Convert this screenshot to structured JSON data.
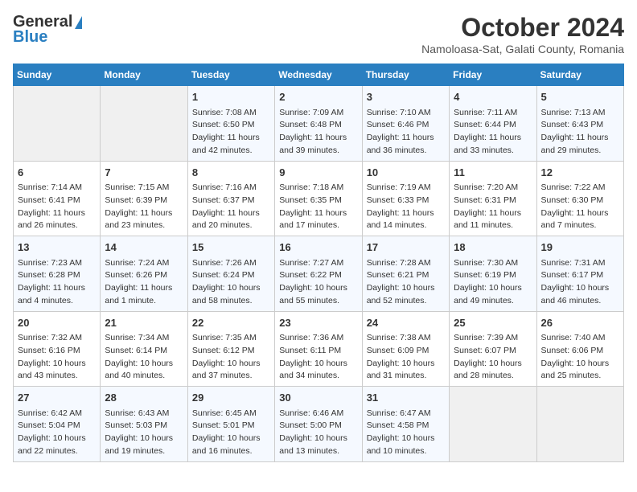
{
  "logo": {
    "line1": "General",
    "line2": "Blue"
  },
  "title": "October 2024",
  "location": "Namoloasa-Sat, Galati County, Romania",
  "days_header": [
    "Sunday",
    "Monday",
    "Tuesday",
    "Wednesday",
    "Thursday",
    "Friday",
    "Saturday"
  ],
  "weeks": [
    [
      {
        "day": "",
        "info": ""
      },
      {
        "day": "",
        "info": ""
      },
      {
        "day": "1",
        "info": "Sunrise: 7:08 AM\nSunset: 6:50 PM\nDaylight: 11 hours and 42 minutes."
      },
      {
        "day": "2",
        "info": "Sunrise: 7:09 AM\nSunset: 6:48 PM\nDaylight: 11 hours and 39 minutes."
      },
      {
        "day": "3",
        "info": "Sunrise: 7:10 AM\nSunset: 6:46 PM\nDaylight: 11 hours and 36 minutes."
      },
      {
        "day": "4",
        "info": "Sunrise: 7:11 AM\nSunset: 6:44 PM\nDaylight: 11 hours and 33 minutes."
      },
      {
        "day": "5",
        "info": "Sunrise: 7:13 AM\nSunset: 6:43 PM\nDaylight: 11 hours and 29 minutes."
      }
    ],
    [
      {
        "day": "6",
        "info": "Sunrise: 7:14 AM\nSunset: 6:41 PM\nDaylight: 11 hours and 26 minutes."
      },
      {
        "day": "7",
        "info": "Sunrise: 7:15 AM\nSunset: 6:39 PM\nDaylight: 11 hours and 23 minutes."
      },
      {
        "day": "8",
        "info": "Sunrise: 7:16 AM\nSunset: 6:37 PM\nDaylight: 11 hours and 20 minutes."
      },
      {
        "day": "9",
        "info": "Sunrise: 7:18 AM\nSunset: 6:35 PM\nDaylight: 11 hours and 17 minutes."
      },
      {
        "day": "10",
        "info": "Sunrise: 7:19 AM\nSunset: 6:33 PM\nDaylight: 11 hours and 14 minutes."
      },
      {
        "day": "11",
        "info": "Sunrise: 7:20 AM\nSunset: 6:31 PM\nDaylight: 11 hours and 11 minutes."
      },
      {
        "day": "12",
        "info": "Sunrise: 7:22 AM\nSunset: 6:30 PM\nDaylight: 11 hours and 7 minutes."
      }
    ],
    [
      {
        "day": "13",
        "info": "Sunrise: 7:23 AM\nSunset: 6:28 PM\nDaylight: 11 hours and 4 minutes."
      },
      {
        "day": "14",
        "info": "Sunrise: 7:24 AM\nSunset: 6:26 PM\nDaylight: 11 hours and 1 minute."
      },
      {
        "day": "15",
        "info": "Sunrise: 7:26 AM\nSunset: 6:24 PM\nDaylight: 10 hours and 58 minutes."
      },
      {
        "day": "16",
        "info": "Sunrise: 7:27 AM\nSunset: 6:22 PM\nDaylight: 10 hours and 55 minutes."
      },
      {
        "day": "17",
        "info": "Sunrise: 7:28 AM\nSunset: 6:21 PM\nDaylight: 10 hours and 52 minutes."
      },
      {
        "day": "18",
        "info": "Sunrise: 7:30 AM\nSunset: 6:19 PM\nDaylight: 10 hours and 49 minutes."
      },
      {
        "day": "19",
        "info": "Sunrise: 7:31 AM\nSunset: 6:17 PM\nDaylight: 10 hours and 46 minutes."
      }
    ],
    [
      {
        "day": "20",
        "info": "Sunrise: 7:32 AM\nSunset: 6:16 PM\nDaylight: 10 hours and 43 minutes."
      },
      {
        "day": "21",
        "info": "Sunrise: 7:34 AM\nSunset: 6:14 PM\nDaylight: 10 hours and 40 minutes."
      },
      {
        "day": "22",
        "info": "Sunrise: 7:35 AM\nSunset: 6:12 PM\nDaylight: 10 hours and 37 minutes."
      },
      {
        "day": "23",
        "info": "Sunrise: 7:36 AM\nSunset: 6:11 PM\nDaylight: 10 hours and 34 minutes."
      },
      {
        "day": "24",
        "info": "Sunrise: 7:38 AM\nSunset: 6:09 PM\nDaylight: 10 hours and 31 minutes."
      },
      {
        "day": "25",
        "info": "Sunrise: 7:39 AM\nSunset: 6:07 PM\nDaylight: 10 hours and 28 minutes."
      },
      {
        "day": "26",
        "info": "Sunrise: 7:40 AM\nSunset: 6:06 PM\nDaylight: 10 hours and 25 minutes."
      }
    ],
    [
      {
        "day": "27",
        "info": "Sunrise: 6:42 AM\nSunset: 5:04 PM\nDaylight: 10 hours and 22 minutes."
      },
      {
        "day": "28",
        "info": "Sunrise: 6:43 AM\nSunset: 5:03 PM\nDaylight: 10 hours and 19 minutes."
      },
      {
        "day": "29",
        "info": "Sunrise: 6:45 AM\nSunset: 5:01 PM\nDaylight: 10 hours and 16 minutes."
      },
      {
        "day": "30",
        "info": "Sunrise: 6:46 AM\nSunset: 5:00 PM\nDaylight: 10 hours and 13 minutes."
      },
      {
        "day": "31",
        "info": "Sunrise: 6:47 AM\nSunset: 4:58 PM\nDaylight: 10 hours and 10 minutes."
      },
      {
        "day": "",
        "info": ""
      },
      {
        "day": "",
        "info": ""
      }
    ]
  ]
}
